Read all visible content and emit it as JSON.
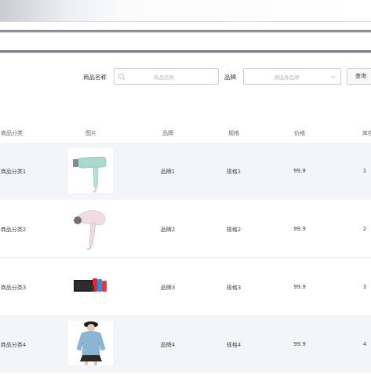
{
  "search": {
    "name_label": "商品名称",
    "name_placeholder": "商品名称",
    "brand_label": "品牌",
    "brand_placeholder": "请选择品牌",
    "query_button": "查询"
  },
  "table": {
    "headers": [
      "商品分类",
      "图片",
      "品牌",
      "规格",
      "价格",
      "库存"
    ],
    "rows": [
      {
        "category": "商品分类1",
        "image": "hair-dryer-mint",
        "brand": "品牌1",
        "spec": "规格1",
        "price": "99.9",
        "stock": "1"
      },
      {
        "category": "商品分类2",
        "image": "hair-dryer-pink",
        "brand": "品牌2",
        "spec": "规格2",
        "price": "99.9",
        "stock": "2"
      },
      {
        "category": "商品分类3",
        "image": "game-console",
        "brand": "品牌3",
        "spec": "规格3",
        "price": "99.9",
        "stock": "3"
      },
      {
        "category": "商品分类4",
        "image": "blue-sweater-outfit",
        "brand": "品牌4",
        "spec": "规格4",
        "price": "99.9",
        "stock": "4"
      }
    ]
  },
  "icons": {
    "search": "search-icon",
    "dropdown": "chevron-down-icon"
  }
}
